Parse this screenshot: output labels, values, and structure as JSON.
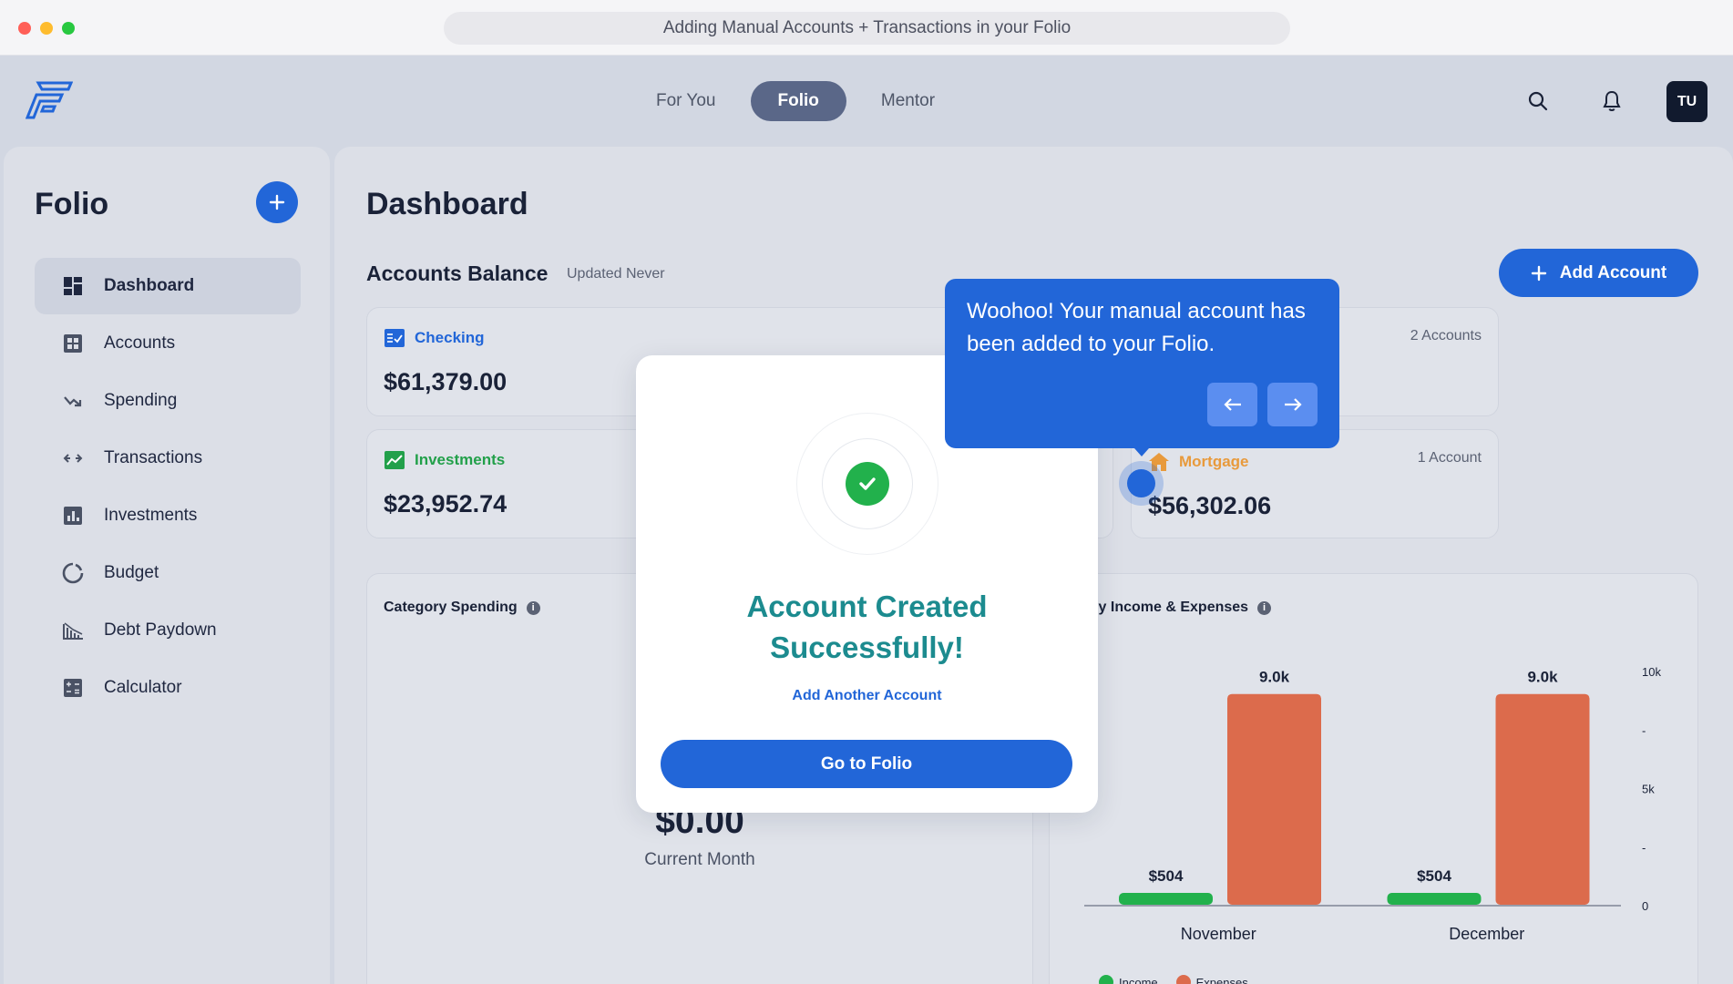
{
  "browser": {
    "title": "Adding Manual Accounts + Transactions in your Folio"
  },
  "topnav": {
    "tabs": [
      {
        "label": "For You",
        "active": false
      },
      {
        "label": "Folio",
        "active": true
      },
      {
        "label": "Mentor",
        "active": false
      }
    ],
    "avatar_initials": "TU",
    "icons": [
      "logo-icon",
      "search-icon",
      "bell-icon"
    ]
  },
  "sidebar": {
    "title": "Folio",
    "items": [
      {
        "label": "Dashboard",
        "icon": "dashboard-icon",
        "active": true
      },
      {
        "label": "Accounts",
        "icon": "accounts-icon",
        "active": false
      },
      {
        "label": "Spending",
        "icon": "spending-icon",
        "active": false
      },
      {
        "label": "Transactions",
        "icon": "transactions-icon",
        "active": false
      },
      {
        "label": "Investments",
        "icon": "investments-icon",
        "active": false
      },
      {
        "label": "Budget",
        "icon": "budget-icon",
        "active": false
      },
      {
        "label": "Debt Paydown",
        "icon": "debt-icon",
        "active": false
      },
      {
        "label": "Calculator",
        "icon": "calculator-icon",
        "active": false
      }
    ]
  },
  "dashboard": {
    "title": "Dashboard",
    "accounts_balance": {
      "title": "Accounts Balance",
      "updated": "Updated Never"
    },
    "add_account_label": "Add Account",
    "cards": {
      "checking": {
        "label": "Checking",
        "amount": "$61,379.00",
        "color": "#2266d8"
      },
      "investments": {
        "label": "Investments",
        "amount": "$23,952.74",
        "color": "#22a04a"
      },
      "top_right": {
        "count": "2 Accounts"
      },
      "mortgage": {
        "label": "Mortgage",
        "amount": "$56,302.06",
        "count": "1 Account",
        "color": "#e89a3c"
      }
    },
    "category_spending": {
      "title": "Category Spending",
      "amount": "$0.00",
      "subtitle": "Current Month"
    },
    "income_expenses": {
      "title_visible": "thly Income & Expenses"
    }
  },
  "chart_data": {
    "type": "bar",
    "categories": [
      "November",
      "December"
    ],
    "series": [
      {
        "name": "Income",
        "values": [
          504,
          504
        ],
        "labels": [
          "$504",
          "$504"
        ],
        "color": "#22b14c"
      },
      {
        "name": "Expenses",
        "values": [
          9000,
          9000
        ],
        "labels": [
          "9.0k",
          "9.0k"
        ],
        "color": "#dc6b4c"
      }
    ],
    "ylim": [
      0,
      10000
    ],
    "yticks": [
      "10k",
      "-",
      "5k",
      "-",
      "0"
    ],
    "legend": [
      "Income",
      "Expenses"
    ],
    "legend_position": "bottom-left"
  },
  "modal": {
    "title_line1": "Account Created",
    "title_line2": "Successfully!",
    "link": "Add Another Account",
    "button": "Go to Folio",
    "accent": "#1c8b8f"
  },
  "tooltip": {
    "text": "Woohoo! Your manual account has been added to your Folio."
  }
}
